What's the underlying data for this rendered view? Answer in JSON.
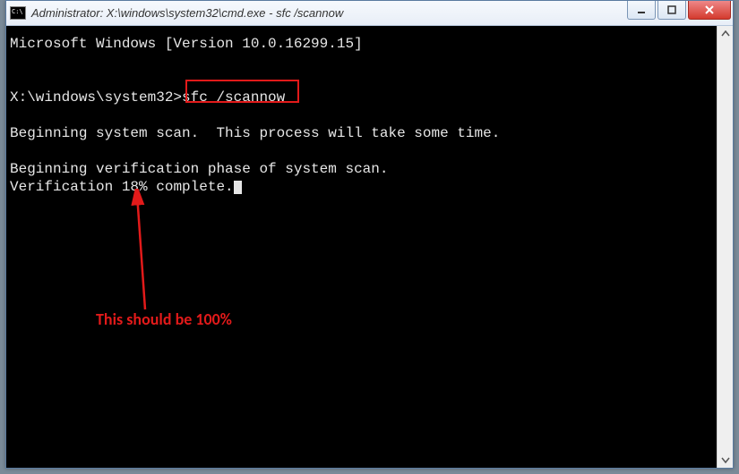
{
  "titlebar": {
    "title": "Administrator: X:\\windows\\system32\\cmd.exe - sfc  /scannow"
  },
  "console": {
    "line_version": "Microsoft Windows [Version 10.0.16299.15]",
    "prompt": "X:\\windows\\system32>",
    "command": "sfc /scannow",
    "line_beginscan": "Beginning system scan.  This process will take some time.",
    "line_beginverify": "Beginning verification phase of system scan.",
    "line_progress_prefix": "Verification ",
    "progress_percent": "18%",
    "line_progress_suffix": " complete."
  },
  "annotation": {
    "text": "This should be 100%"
  },
  "icons": {
    "cmd": "cmd-icon",
    "minimize": "minimize-icon",
    "maximize": "maximize-icon",
    "close": "close-icon",
    "scroll_up": "chevron-up-icon",
    "scroll_down": "chevron-down-icon"
  },
  "colors": {
    "highlight": "#e21a1a",
    "console_bg": "#000000",
    "console_fg": "#e6e6e6"
  }
}
